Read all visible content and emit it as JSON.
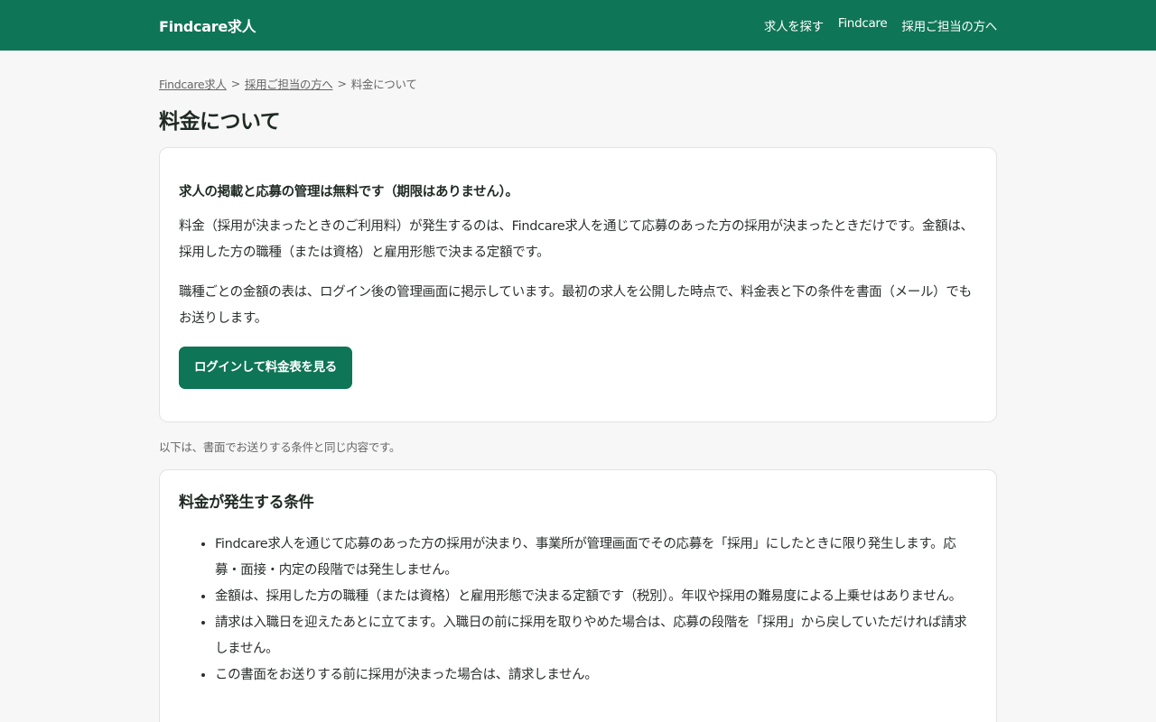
{
  "header": {
    "brand": "Findcare求人",
    "nav": [
      "求人を探す",
      "Findcare",
      "採用ご担当の方へ"
    ]
  },
  "breadcrumb": {
    "items": [
      "Findcare求人",
      "採用ご担当の方へ"
    ],
    "current": "料金について",
    "separator": ">"
  },
  "page_title": "料金について",
  "intro": {
    "lead": "求人の掲載と応募の管理は無料です（期限はありません）。",
    "paragraphs": [
      "料金（採用が決まったときのご利用料）が発生するのは、Findcare求人を通じて応募のあった方の採用が決まったときだけです。金額は、採用した方の職種（または資格）と雇用形態で決まる定額です。",
      "職種ごとの金額の表は、ログイン後の管理画面に掲示しています。最初の求人を公開した時点で、料金表と下の条件を書面（メール）でもお送りします。"
    ],
    "cta_label": "ログインして料金表を見る"
  },
  "note": "以下は、書面でお送りする条件と同じ内容です。",
  "conditions": {
    "title": "料金が発生する条件",
    "items": [
      "Findcare求人を通じて応募のあった方の採用が決まり、事業所が管理画面でその応募を「採用」にしたときに限り発生します。応募・面接・内定の段階では発生しません。",
      "金額は、採用した方の職種（または資格）と雇用形態で決まる定額です（税別）。年収や採用の難易度による上乗せはありません。",
      "請求は入職日を迎えたあとに立てます。入職日の前に採用を取りやめた場合は、応募の段階を「採用」から戻していただければ請求しません。",
      "この書面をお送りする前に採用が決まった場合は、請求しません。"
    ]
  },
  "colors": {
    "brand": "#0e7556",
    "background": "#f7f7f7",
    "card": "#ffffff"
  }
}
